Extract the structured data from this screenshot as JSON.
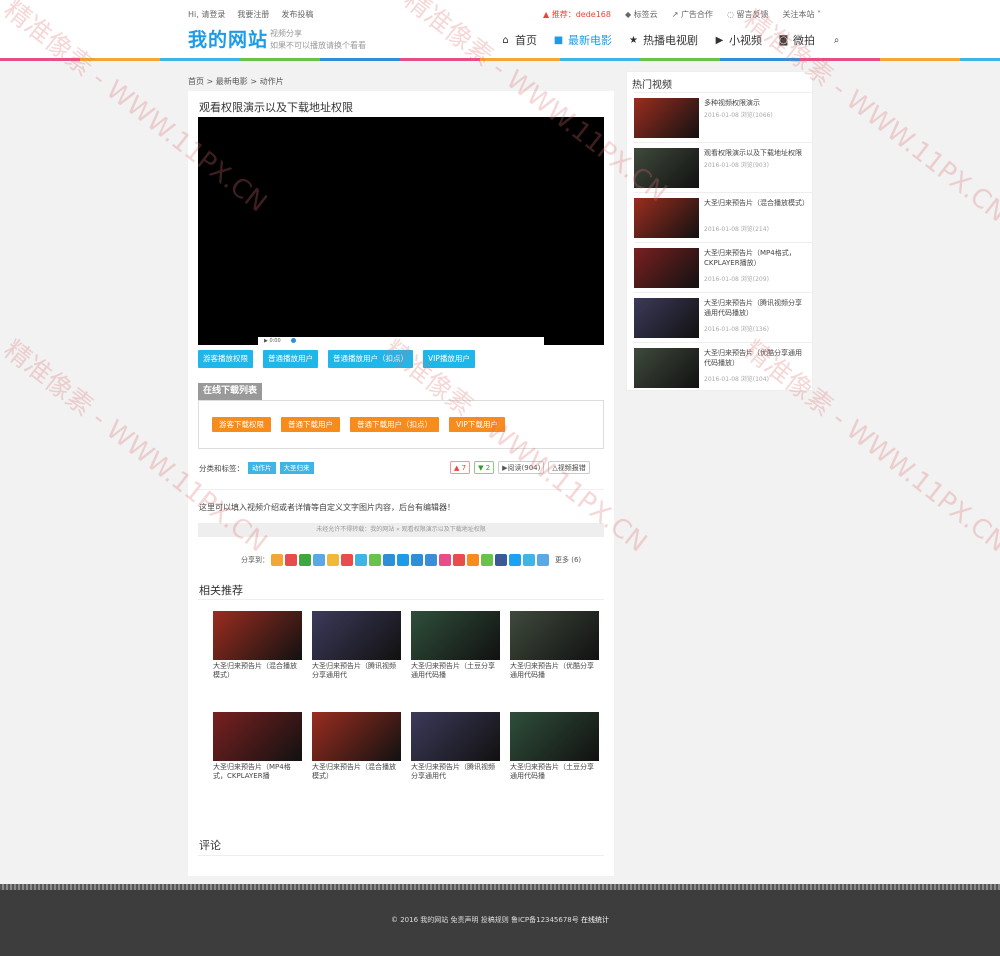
{
  "topbar": {
    "left": [
      "Hi, 请登录",
      "我要注册",
      "发布投稿"
    ],
    "recommend": "推荐：dede168",
    "right": [
      "标签云",
      "广告合作",
      "留言反馈",
      "关注本站"
    ]
  },
  "site": {
    "logo": "我的网站",
    "slogan1": "视频分享",
    "slogan2": "如果不可以播放请换个看看"
  },
  "nav": [
    {
      "label": "首页",
      "icon": "home-icon",
      "glyph": "⌂"
    },
    {
      "label": "最新电影",
      "icon": "video-camera-icon",
      "glyph": "■"
    },
    {
      "label": "热播电视剧",
      "icon": "star-icon",
      "glyph": "★"
    },
    {
      "label": "小视频",
      "icon": "play-square-icon",
      "glyph": "▶"
    },
    {
      "label": "微拍",
      "icon": "camera-icon",
      "glyph": "◙"
    }
  ],
  "breadcrumb": "首页 > 最新电影 > 动作片",
  "article": {
    "title": "观看权限演示以及下载地址权限",
    "player_time": "0:00",
    "play_buttons": [
      "游客播放权限",
      "普通播放用户",
      "普通播放用户（扣点）",
      "VIP播放用户"
    ],
    "download_title": "在线下载列表",
    "download_buttons": [
      "游客下载权限",
      "普通下载用户",
      "普通下载用户（扣点）",
      "VIP下载用户"
    ],
    "tags_label": "分类和标签：",
    "tags": [
      "动作片",
      "大圣归来"
    ],
    "likes": "7",
    "dislikes": "2",
    "views": "阅读(904)",
    "report": "视频报错",
    "intro": "这里可以填入视频介绍或者详情等自定义文字图片内容，后台有编辑器！",
    "copy_note": "未经允许不得转载：我的网站 » 观看权限演示以及下载地址权限",
    "share_label": "分享到：",
    "share_more": "更多 (6)",
    "share_colors": [
      "#f1a635",
      "#e84c4c",
      "#3ea73e",
      "#5aa9e6",
      "#f0b93a",
      "#e84c4c",
      "#3fb4e5",
      "#69c24a",
      "#2e8fd8",
      "#1e9be6",
      "#2e8fd8",
      "#3a8ed8",
      "#e84c89",
      "#e84c4c",
      "#f68b1e",
      "#69c24a",
      "#3b5998",
      "#1da1f2",
      "#3fb4e5",
      "#5aa9e6"
    ]
  },
  "related": {
    "title": "相关推荐",
    "items": [
      {
        "caption": "大圣归来预告片（混合播放模式）",
        "color": "#9b2d1f"
      },
      {
        "caption": "大圣归来预告片（腾讯视频分享通用代",
        "color": "#3c3a5a"
      },
      {
        "caption": "大圣归来预告片（土豆分享通用代码播",
        "color": "#2f4f3a"
      },
      {
        "caption": "大圣归来预告片（优酷分享通用代码播",
        "color": "#3f4a3c"
      },
      {
        "caption": "大圣归来预告片（MP4格式，CKPLAYER播",
        "color": "#7a2020"
      },
      {
        "caption": "大圣归来预告片（混合播放模式）",
        "color": "#9b2d1f"
      },
      {
        "caption": "大圣归来预告片（腾讯视频分享通用代",
        "color": "#3c3a5a"
      },
      {
        "caption": "大圣归来预告片（土豆分享通用代码播",
        "color": "#2f4f3a"
      }
    ]
  },
  "comments": {
    "title": "评论"
  },
  "sidebar": {
    "title": "热门视频",
    "items": [
      {
        "title": "多种视频权限演示",
        "meta": "2016-01-08  浏览(1066)",
        "color": "#9b2d1f"
      },
      {
        "title": "观看权限演示以及下载地址权限",
        "meta": "2016-01-08  浏览(903)",
        "color": "#3f4a3c"
      },
      {
        "title": "大圣归来预告片（混合播放模式）",
        "meta": "2016-01-08  浏览(214)",
        "color": "#9b2d1f"
      },
      {
        "title": "大圣归来预告片（MP4格式，CKPLAYER播放）",
        "meta": "2016-01-08  浏览(209)",
        "color": "#7a2020"
      },
      {
        "title": "大圣归来预告片（腾讯视频分享通用代码播放）",
        "meta": "2016-01-08  浏览(136)",
        "color": "#3c3a5a"
      },
      {
        "title": "大圣归来预告片（优酷分享通用代码播放）",
        "meta": "2016-01-08  浏览(104)",
        "color": "#3f4a3c"
      }
    ]
  },
  "footer": {
    "text": "© 2016 我的网站  免责声明  投稿规则  鲁ICP备12345678号",
    "stats": "在线统计"
  },
  "watermark": [
    "精准像素 - WWW.11PX.CN",
    "精准像素 - WWW.11PX.CN",
    "精准像素 - WWW.11PX.CN",
    "精准像素 - WWW.11PX.CN",
    "精准像素 - WWW.11PX.CN",
    "精准像素 - WWW.11PX.CN"
  ]
}
